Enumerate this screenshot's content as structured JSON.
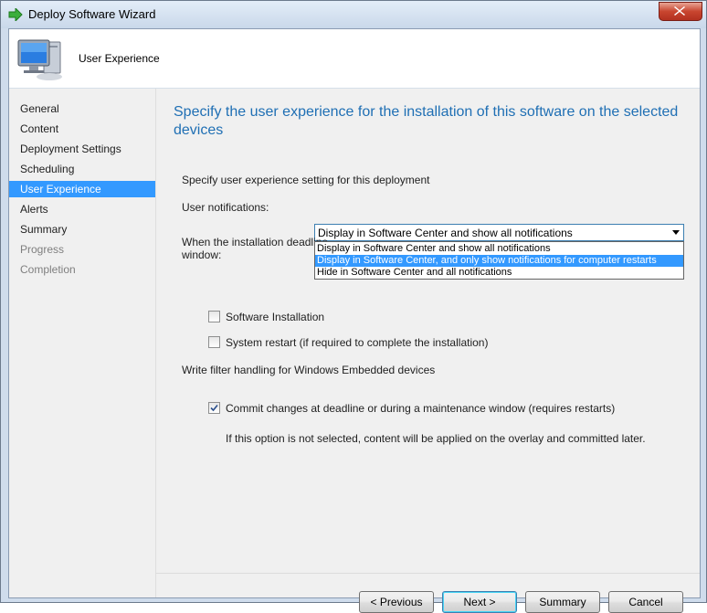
{
  "window": {
    "title": "Deploy Software Wizard",
    "title_icon": "green-arrow-icon",
    "close_icon": "close-icon"
  },
  "header": {
    "title": "User Experience",
    "icon": "computer-icon"
  },
  "nav": {
    "items": [
      {
        "label": "General",
        "state": "normal"
      },
      {
        "label": "Content",
        "state": "normal"
      },
      {
        "label": "Deployment Settings",
        "state": "normal"
      },
      {
        "label": "Scheduling",
        "state": "normal"
      },
      {
        "label": "User Experience",
        "state": "selected"
      },
      {
        "label": "Alerts",
        "state": "normal"
      },
      {
        "label": "Summary",
        "state": "normal"
      },
      {
        "label": "Progress",
        "state": "disabled"
      },
      {
        "label": "Completion",
        "state": "disabled"
      }
    ]
  },
  "main": {
    "title": "Specify the user experience for the installation of this software on the selected devices",
    "section_label": "Specify user experience setting for this deployment",
    "user_notifications_label": "User notifications:",
    "user_notifications": {
      "selected": "Display in Software Center and show all notifications",
      "options": [
        "Display in Software Center and show all notifications",
        "Display in Software Center, and only show notifications for computer restarts",
        "Hide in Software Center and all notifications"
      ],
      "highlighted_index": 1
    },
    "deadline_label_line1": "When the installation deadline",
    "deadline_label_line2": "window:",
    "software_installation": {
      "label": "Software Installation",
      "checked": false
    },
    "system_restart": {
      "label": "System restart  (if required to complete the installation)",
      "checked": false
    },
    "write_filter_label": "Write filter handling for Windows Embedded devices",
    "commit_changes": {
      "label": "Commit changes at deadline or during a maintenance window (requires restarts)",
      "checked": true
    },
    "commit_note": "If this option is not selected, content will be applied on the overlay and committed later."
  },
  "buttons": {
    "previous": "< Previous",
    "next": "Next >",
    "summary": "Summary",
    "cancel": "Cancel"
  },
  "colors": {
    "accent": "#1f6fb4",
    "selection": "#3399ff",
    "panel_bg": "#f0f0f0"
  }
}
